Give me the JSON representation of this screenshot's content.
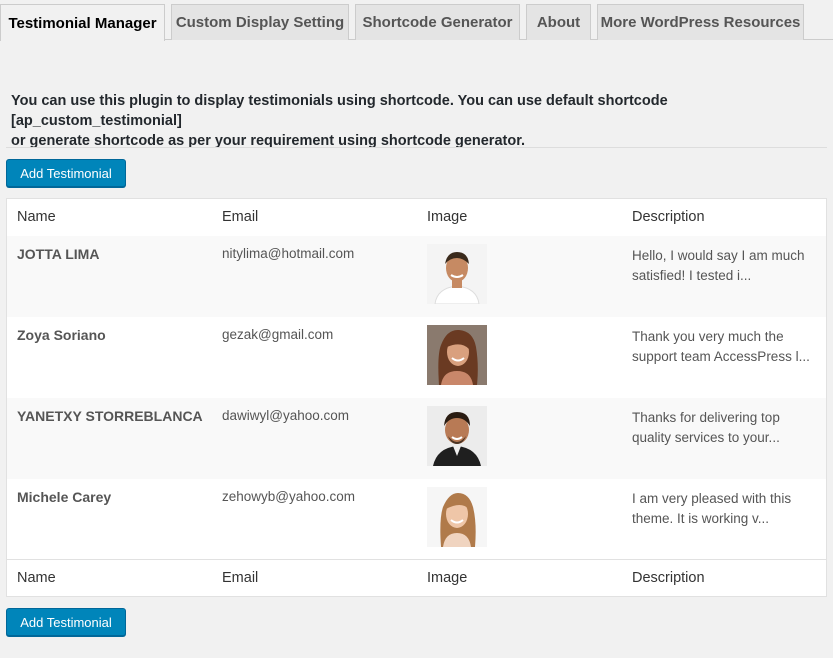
{
  "tabs": [
    {
      "label": "Testimonial Manager",
      "active": true
    },
    {
      "label": "Custom Display Setting",
      "active": false
    },
    {
      "label": "Shortcode Generator",
      "active": false
    },
    {
      "label": "About",
      "active": false
    },
    {
      "label": "More WordPress Resources",
      "active": false
    }
  ],
  "intro": {
    "line1": "You can use this plugin to display testimonials using shortcode. You can use default shortcode  [ap_custom_testimonial]",
    "line2": "or generate shortcode as per your requirement using shortcode generator."
  },
  "add_button_label": "Add Testimonial",
  "table": {
    "columns": [
      "Name",
      "Email",
      "Image",
      "Description"
    ],
    "rows": [
      {
        "name": "JOTTA LIMA",
        "email": "nitylima@hotmail.com",
        "desc1": "Hello, I would say I am much",
        "desc2": "satisfied! I tested i..."
      },
      {
        "name": "Zoya Soriano",
        "email": "gezak@gmail.com",
        "desc1": "Thank you very much the",
        "desc2": "support team AccessPress l..."
      },
      {
        "name": "YANETXY STORREBLANCA",
        "email": "dawiwyl@yahoo.com",
        "desc1": "Thanks for delivering top",
        "desc2": "quality services to your..."
      },
      {
        "name": "Michele Carey",
        "email": "zehowyb@yahoo.com",
        "desc1": "I am very pleased with this",
        "desc2": "theme. It is working v..."
      }
    ]
  },
  "colors": {
    "primary": "#0085ba",
    "primary_border": "#006799"
  }
}
